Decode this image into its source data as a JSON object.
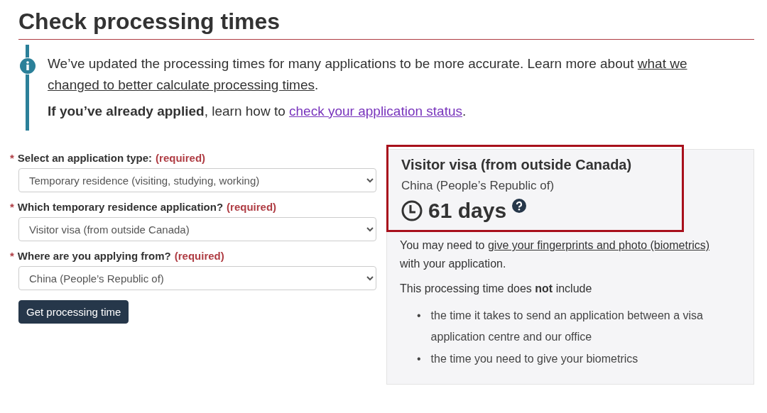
{
  "title": "Check processing times",
  "alert": {
    "paragraphs": [
      {
        "parts": [
          {
            "kind": "text",
            "text": "We’ve updated the processing times for many applications to be more accurate. Learn more about "
          },
          {
            "kind": "link",
            "text": "what we"
          },
          {
            "kind": "gap"
          },
          {
            "kind": "link",
            "text": "changed to better calculate processing times"
          },
          {
            "kind": "text",
            "text": "."
          }
        ]
      },
      {
        "parts": [
          {
            "kind": "text",
            "text": "**If you’ve already applied**, learn how to "
          },
          {
            "kind": "visited_link",
            "text": "check your application status"
          },
          {
            "kind": "text",
            "text": "."
          }
        ]
      }
    ]
  },
  "form": {
    "fields": [
      {
        "asterisk": "*",
        "label": "Select an application type:",
        "required": "(required)",
        "value": "Temporary residence (visiting, studying, working)"
      },
      {
        "asterisk": "*",
        "label": "Which temporary residence application?",
        "required": "(required)",
        "value": "Visitor visa (from outside Canada)"
      },
      {
        "asterisk": "*",
        "label": "Where are you applying from?",
        "required": "(required)",
        "value": "China (People’s Republic of)"
      }
    ],
    "button": "Get processing time"
  },
  "result": {
    "highlighted": true,
    "heading": "Visitor visa (from outside Canada)",
    "country": "China (People’s Republic of)",
    "time": "61 days",
    "paragraphs": [
      {
        "parts": [
          {
            "kind": "text",
            "text": "You may need to "
          },
          {
            "kind": "link",
            "text": "give your fingerprints and photo (biometrics)"
          },
          {
            "kind": "text",
            "text": " with your application."
          }
        ]
      },
      {
        "parts": [
          {
            "kind": "text",
            "text": "This processing time does **not** include"
          }
        ]
      }
    ],
    "bullets": [
      {
        "marker": "•",
        "text": "the time it takes to send an application between a visa application centre and our office"
      },
      {
        "marker": "•",
        "text": "the time you need to give your biometrics"
      }
    ]
  }
}
